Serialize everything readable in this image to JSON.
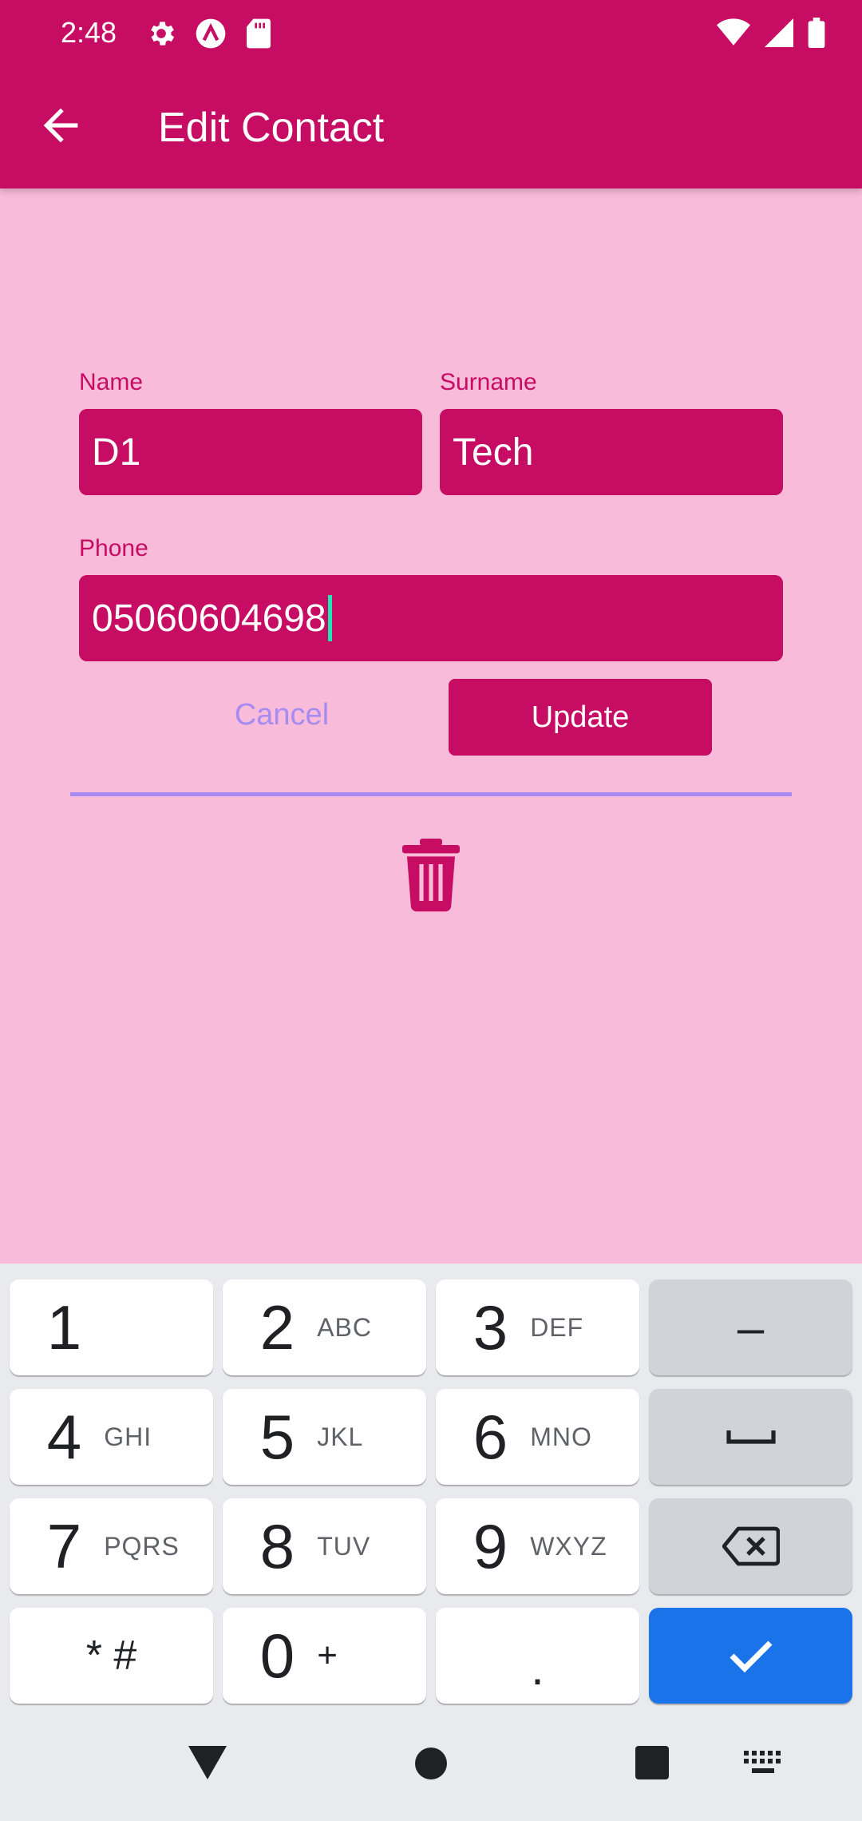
{
  "status_bar": {
    "time": "2:48",
    "left_icons": [
      "gear-icon",
      "a-circle-icon",
      "sd-card-icon"
    ],
    "right_icons": [
      "wifi-icon",
      "signal-icon",
      "battery-icon"
    ]
  },
  "app_bar": {
    "title": "Edit Contact",
    "back_icon": "arrow-back-icon"
  },
  "form": {
    "name": {
      "label": "Name",
      "value": "D1"
    },
    "surname": {
      "label": "Surname",
      "value": "Tech"
    },
    "phone": {
      "label": "Phone",
      "value": "05060604698"
    },
    "cancel_label": "Cancel",
    "update_label": "Update",
    "delete_icon": "trash-icon"
  },
  "colors": {
    "primary": "#C60C63",
    "background": "#F8BBD9",
    "accent": "#A78BF0",
    "caret": "#1DE9B6",
    "keyboard_action": "#1A73E8"
  },
  "keyboard": {
    "rows": [
      [
        {
          "digit": "1",
          "letters": ""
        },
        {
          "digit": "2",
          "letters": "ABC"
        },
        {
          "digit": "3",
          "letters": "DEF"
        },
        {
          "symbol": "–"
        }
      ],
      [
        {
          "digit": "4",
          "letters": "GHI"
        },
        {
          "digit": "5",
          "letters": "JKL"
        },
        {
          "digit": "6",
          "letters": "MNO"
        },
        {
          "icon": "space-icon"
        }
      ],
      [
        {
          "digit": "7",
          "letters": "PQRS"
        },
        {
          "digit": "8",
          "letters": "TUV"
        },
        {
          "digit": "9",
          "letters": "WXYZ"
        },
        {
          "icon": "backspace-icon"
        }
      ],
      [
        {
          "symbol": "* #"
        },
        {
          "digit": "0",
          "letters": "+"
        },
        {
          "symbol": "."
        },
        {
          "icon": "checkmark-icon"
        }
      ]
    ]
  },
  "nav_bar": {
    "icons": [
      "back-triangle-icon",
      "home-circle-icon",
      "recents-square-icon",
      "keyboard-icon"
    ]
  }
}
